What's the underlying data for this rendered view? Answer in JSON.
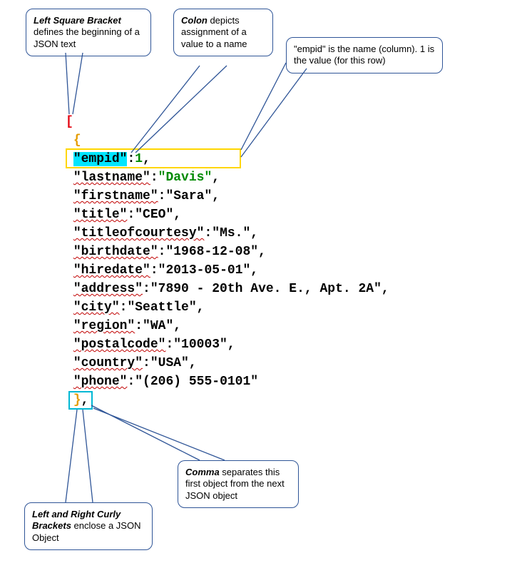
{
  "callouts": {
    "leftBracket": {
      "text_prefix": "Left Square Bracket",
      "text_rest": " defines the beginning of a JSON text"
    },
    "colon": {
      "text_prefix": "Colon",
      "text_rest": " depicts assignment of a value to a name"
    },
    "empidName": {
      "text": "\"empid\" is the name (column). 1 is the value (for this row)"
    },
    "curly": {
      "text_prefix": "Left and Right Curly Brackets",
      "text_rest": " enclose a JSON Object"
    },
    "comma": {
      "text_prefix": "Comma",
      "text_rest": " separates this first object from the next JSON object"
    }
  },
  "json_code": {
    "open_array": "[",
    "open_object": "{",
    "rows": [
      {
        "key": "\"empid\"",
        "sep": ":",
        "value": "1",
        "valueClass": "num-green",
        "trail": ",",
        "keyClass": "key-hl"
      },
      {
        "key": "\"lastname\"",
        "sep": ":",
        "value": "\"Davis\"",
        "valueClass": "str-green",
        "trail": ","
      },
      {
        "key": "\"firstname\"",
        "sep": ":",
        "value": "\"Sara\"",
        "trail": ","
      },
      {
        "key": "\"title\"",
        "sep": ":",
        "value": "\"CEO\"",
        "trail": ","
      },
      {
        "key": "\"titleofcourtesy\"",
        "sep": ":",
        "value": "\"Ms.\"",
        "trail": ","
      },
      {
        "key": "\"birthdate\"",
        "sep": ":",
        "value": "\"1968-12-08\"",
        "trail": ","
      },
      {
        "key": "\"hiredate\"",
        "sep": ":",
        "value": "\"2013-05-01\"",
        "trail": ","
      },
      {
        "key": "\"address\"",
        "sep": ":",
        "value": "\"7890 - 20th Ave. E., Apt. 2A\"",
        "trail": ","
      },
      {
        "key": "\"city\"",
        "sep": ":",
        "value": "\"Seattle\"",
        "trail": ","
      },
      {
        "key": "\"region\"",
        "sep": ":",
        "value": "\"WA\"",
        "trail": ","
      },
      {
        "key": "\"postalcode\"",
        "sep": ":",
        "value": "\"10003\"",
        "trail": ","
      },
      {
        "key": "\"country\"",
        "sep": ":",
        "value": "\"USA\"",
        "trail": ","
      },
      {
        "key": "\"phone\"",
        "sep": ":",
        "value": "\"(206) 555-0101\"",
        "trail": ""
      }
    ],
    "close_object": "}",
    "after_close_object": ",",
    "indent_object": " ",
    "indent_row": " "
  }
}
